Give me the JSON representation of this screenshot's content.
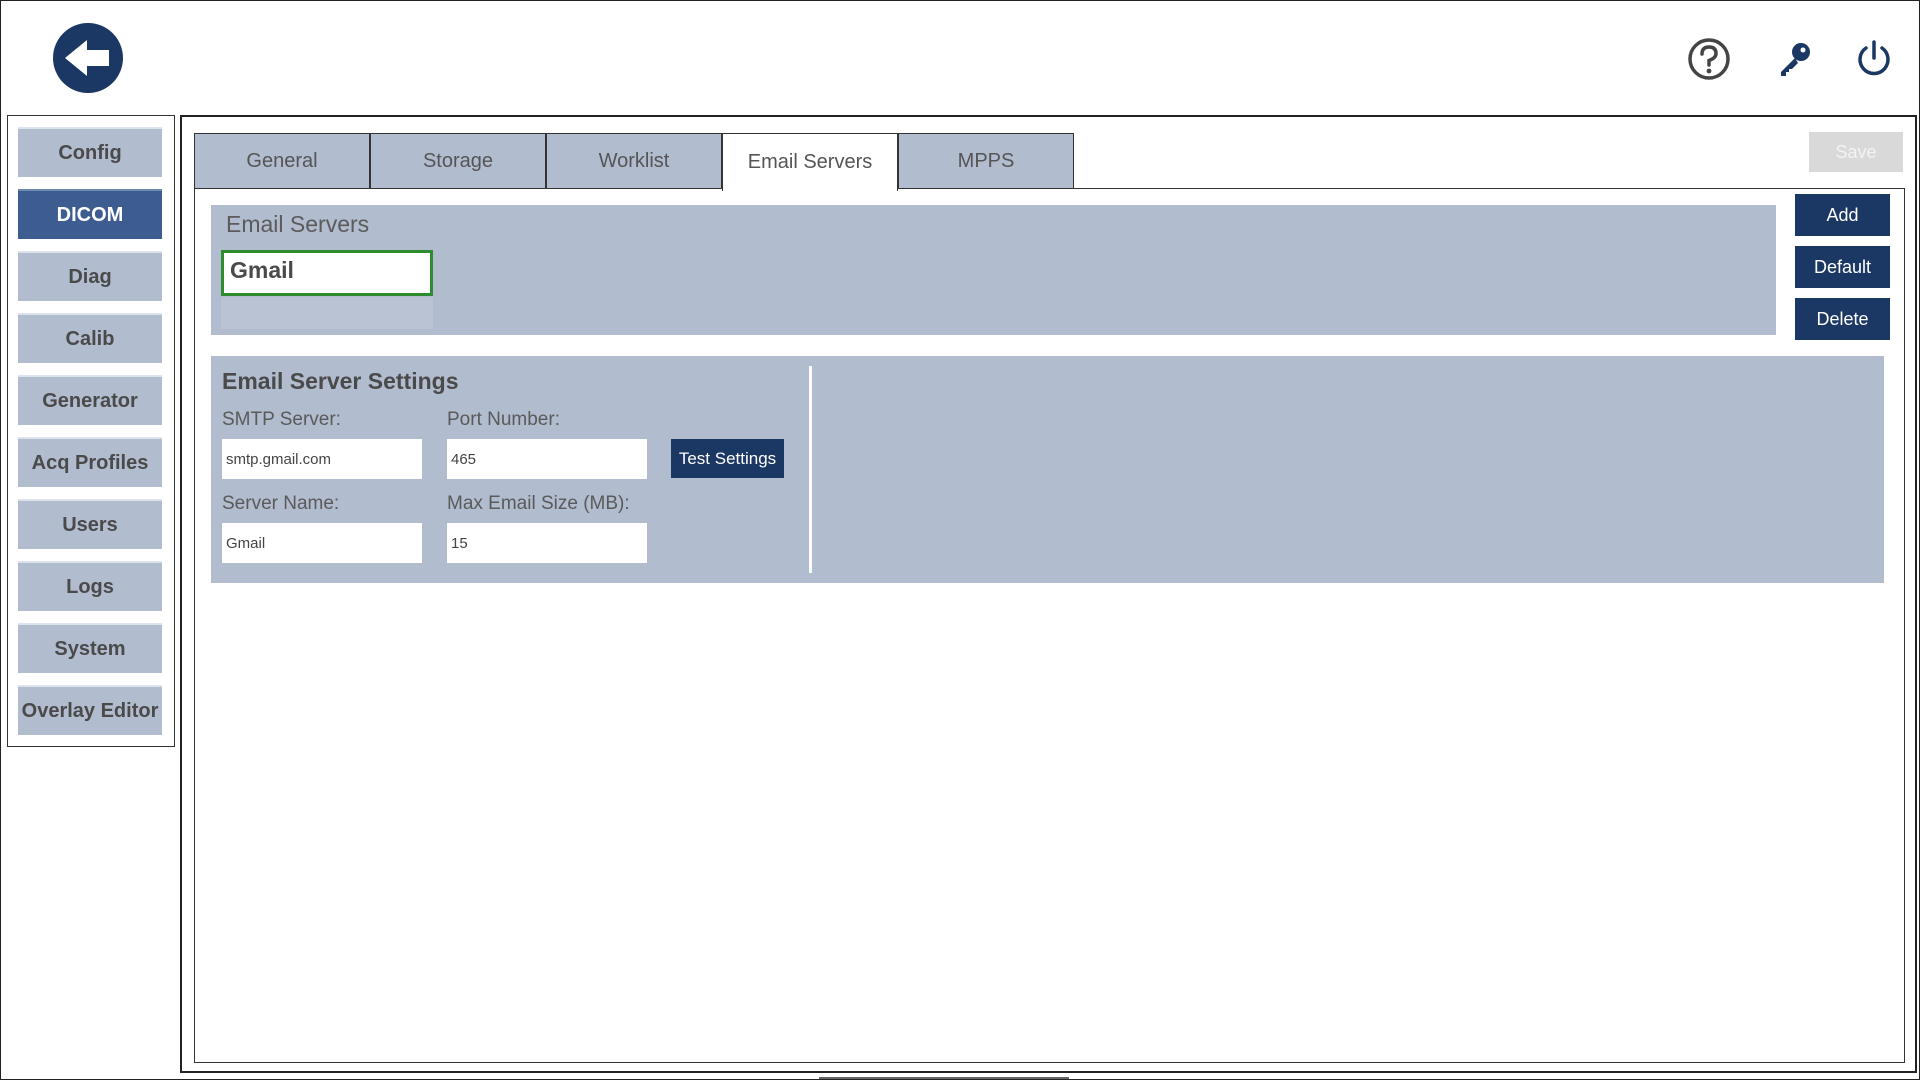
{
  "header": {
    "back_icon": "arrow-left-icon",
    "help_icon": "question-circle-icon",
    "key_icon": "key-icon",
    "power_icon": "power-icon",
    "accent_color": "#1b3764"
  },
  "sidebar": {
    "items": [
      {
        "label": "Config",
        "active": false
      },
      {
        "label": "DICOM",
        "active": true
      },
      {
        "label": "Diag",
        "active": false
      },
      {
        "label": "Calib",
        "active": false
      },
      {
        "label": "Generator",
        "active": false
      },
      {
        "label": "Acq Profiles",
        "active": false
      },
      {
        "label": "Users",
        "active": false
      },
      {
        "label": "Logs",
        "active": false
      },
      {
        "label": "System",
        "active": false
      },
      {
        "label": "Overlay Editor",
        "active": false
      }
    ]
  },
  "tabs": [
    {
      "label": "General",
      "active": false
    },
    {
      "label": "Storage",
      "active": false
    },
    {
      "label": "Worklist",
      "active": false
    },
    {
      "label": "Email Servers",
      "active": true
    },
    {
      "label": "MPPS",
      "active": false
    }
  ],
  "toolbar": {
    "save_label": "Save"
  },
  "servers": {
    "title": "Email Servers",
    "items": [
      "Gmail"
    ],
    "add_label": "Add",
    "default_label": "Default",
    "delete_label": "Delete"
  },
  "settings": {
    "title": "Email Server Settings",
    "smtp_label": "SMTP Server:",
    "smtp_value": "smtp.gmail.com",
    "port_label": "Port Number:",
    "port_value": "465",
    "server_name_label": "Server Name:",
    "server_name_value": "Gmail",
    "max_size_label": "Max Email Size (MB):",
    "max_size_value": "15",
    "test_label": "Test Settings"
  }
}
